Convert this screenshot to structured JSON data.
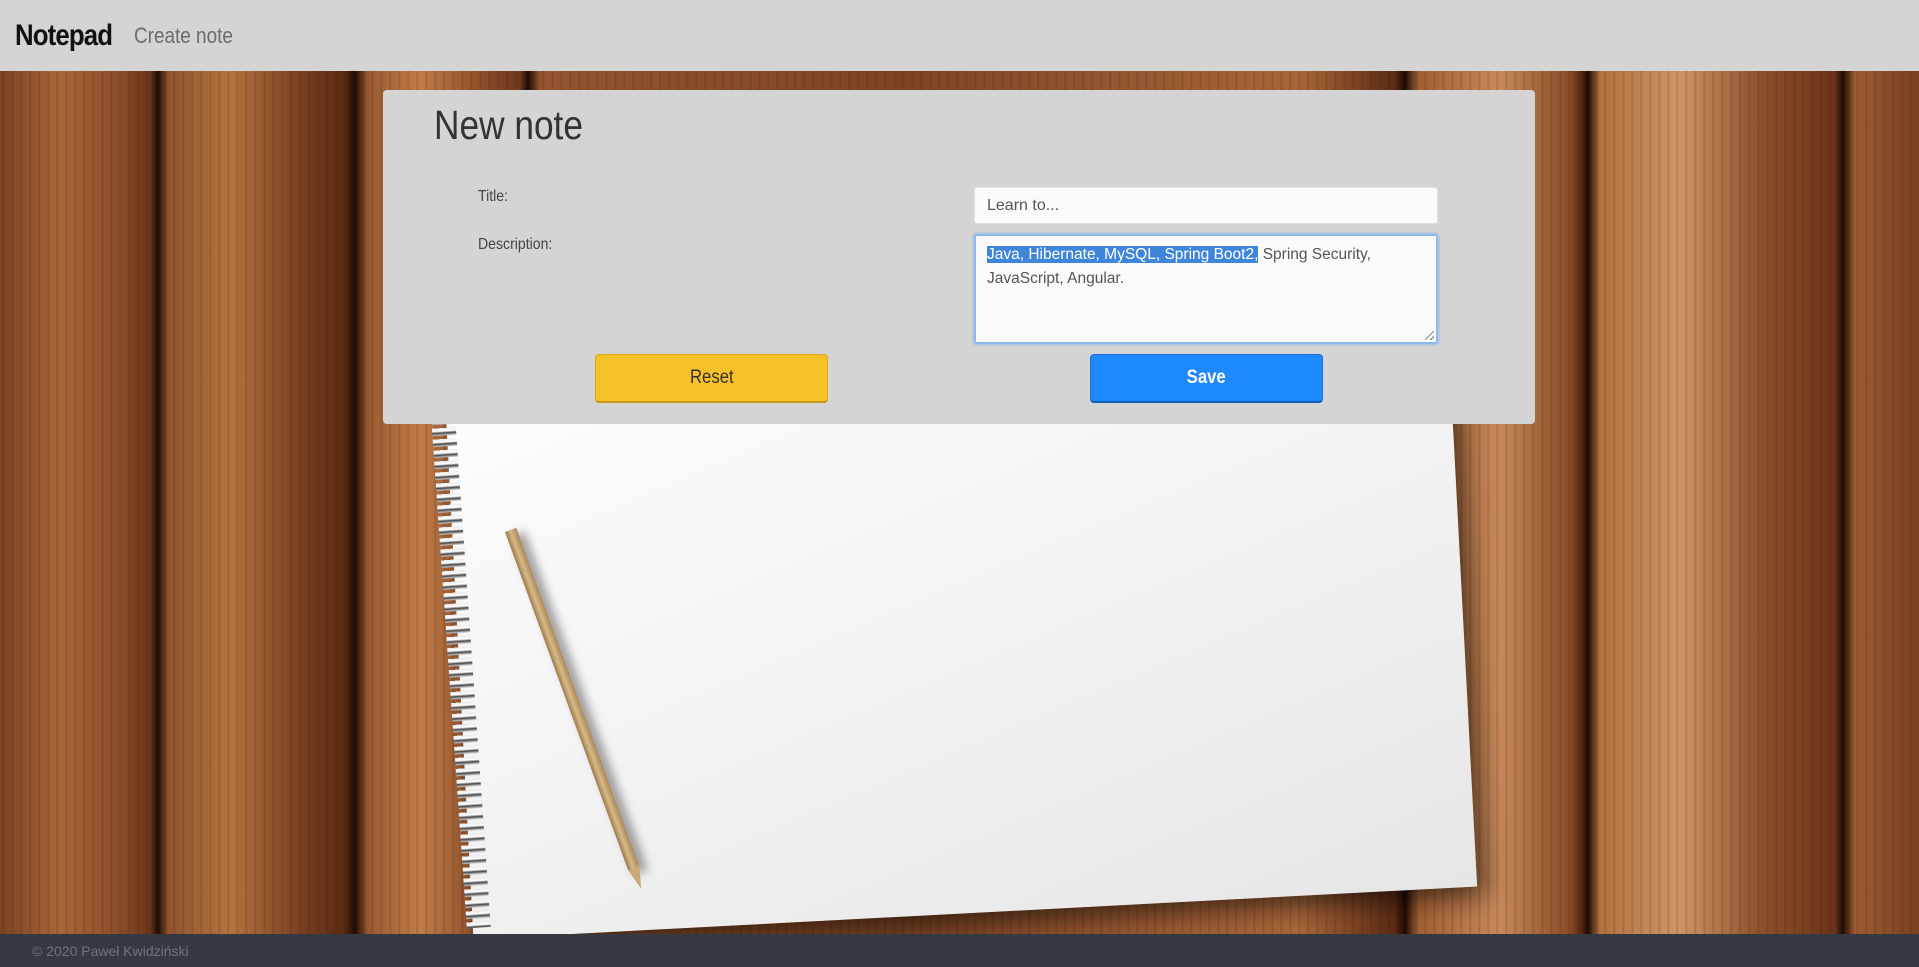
{
  "navbar": {
    "brand": "Notepad",
    "links": [
      {
        "label": "Create note"
      }
    ]
  },
  "form": {
    "heading": "New note",
    "title_label": "Title:",
    "title_placeholder": "Learn to...",
    "title_value": "",
    "description_label": "Description:",
    "description_selected": "Java, Hibernate, MySQL, Spring Boot2,",
    "description_rest": " Spring Security, JavaScript, Angular.",
    "reset_label": "Reset",
    "save_label": "Save"
  },
  "colors": {
    "reset_button": "#f7c12a",
    "save_button": "#1e88ff",
    "navbar_bg": "#d4d4d4",
    "footer_bg": "#343a40"
  },
  "footer": {
    "copyright": "© 2020 Paweł Kwidziński"
  }
}
